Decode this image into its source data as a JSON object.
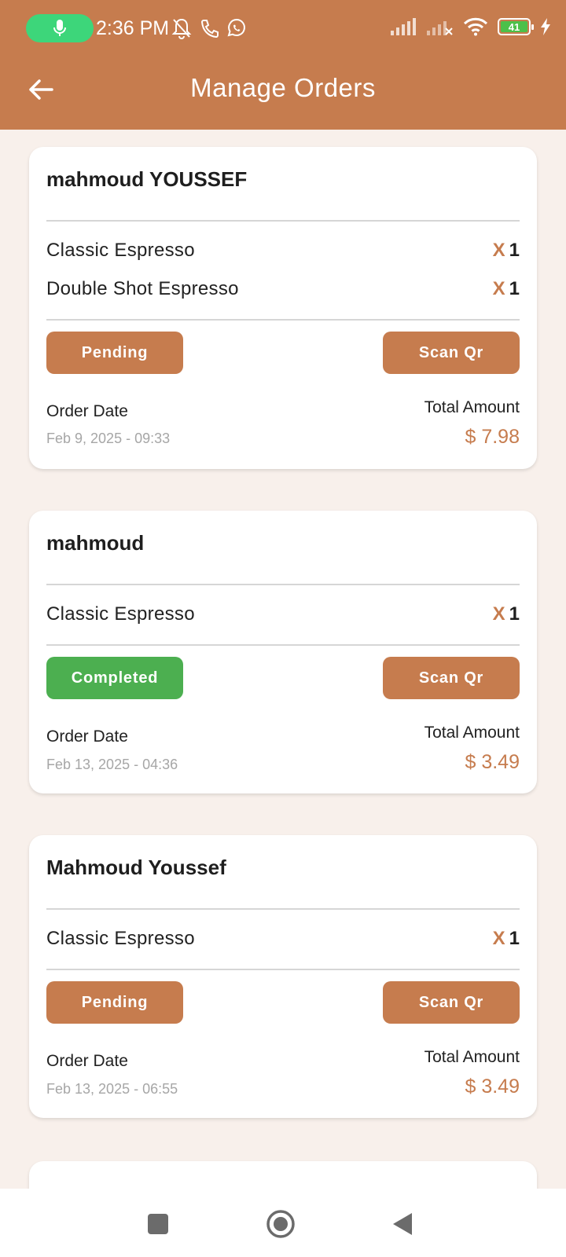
{
  "status_bar": {
    "time": "2:36 PM",
    "battery_level": "41",
    "icons_left": [
      "mic-icon",
      "notifications-off-icon",
      "phone-icon",
      "whatsapp-icon"
    ],
    "icons_right": [
      "signal-icon",
      "signal-no-service-icon",
      "wifi-icon",
      "battery-icon",
      "charging-icon"
    ]
  },
  "header": {
    "title": "Manage Orders",
    "back_icon": "arrow-left-icon"
  },
  "labels": {
    "order_date": "Order Date",
    "total_amount": "Total Amount",
    "scan_qr": "Scan Qr"
  },
  "orders": [
    {
      "customer": "mahmoud YOUSSEF",
      "items": [
        {
          "name": "Classic Espresso",
          "x": "X",
          "qty": "1"
        },
        {
          "name": "Double Shot Espresso",
          "x": "X",
          "qty": "1"
        }
      ],
      "status": "Pending",
      "date": "Feb 9, 2025 - 09:33",
      "total": "$ 7.98"
    },
    {
      "customer": "mahmoud",
      "items": [
        {
          "name": "Classic Espresso",
          "x": "X",
          "qty": "1"
        }
      ],
      "status": "Completed",
      "date": "Feb 13, 2025 - 04:36",
      "total": "$ 3.49"
    },
    {
      "customer": "Mahmoud Youssef",
      "items": [
        {
          "name": "Classic Espresso",
          "x": "X",
          "qty": "1"
        }
      ],
      "status": "Pending",
      "date": "Feb 13, 2025 - 06:55",
      "total": "$ 3.49"
    }
  ],
  "colors": {
    "brand": "#C67C4E",
    "background": "#F8F0EB",
    "completed": "#4CAF50",
    "mic_pill": "#3DD67A"
  },
  "nav_bar": {
    "icons": [
      "recents-square-icon",
      "home-circle-icon",
      "back-triangle-icon"
    ]
  }
}
